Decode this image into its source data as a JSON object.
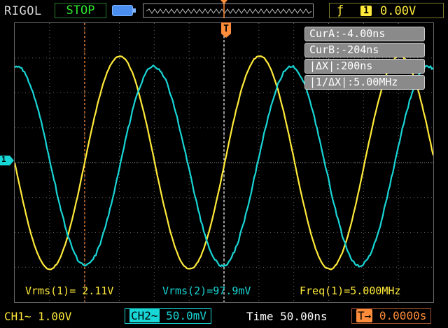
{
  "topbar": {
    "brand": "RIGOL",
    "run_state": "STOP",
    "trigger_edge_icon": "rising-edge-icon",
    "trigger_source": "1",
    "trigger_level": "0.00V",
    "trigger_position_marker": "T"
  },
  "cursor_panel": {
    "cur_a": "CurA:-4.00ns",
    "cur_b": "CurB:-204ns",
    "delta_x": "|ΔX|:200ns",
    "inv_delta_x": "|1/ΔX|:5.00MHz"
  },
  "channel_marker": "1",
  "measurements": {
    "vrms1": "Vrms(1)= 2.11V",
    "vrms2": "Vrms(2)=97.9mV",
    "freq1": "Freq(1)=5.000MHz"
  },
  "bottombar": {
    "ch1_scale": "CH1~  1.00V",
    "ch2_tag": "CH2~",
    "ch2_scale": "50.0mV",
    "timebase": "Time 50.00ns",
    "trigger_offset_tag": "T→",
    "trigger_offset": "0.0000s"
  },
  "colors": {
    "ch1": "#ffea3a",
    "ch2": "#19d6d6",
    "cursor": "#ff8c3a",
    "grid": "#6a6a6a"
  }
}
